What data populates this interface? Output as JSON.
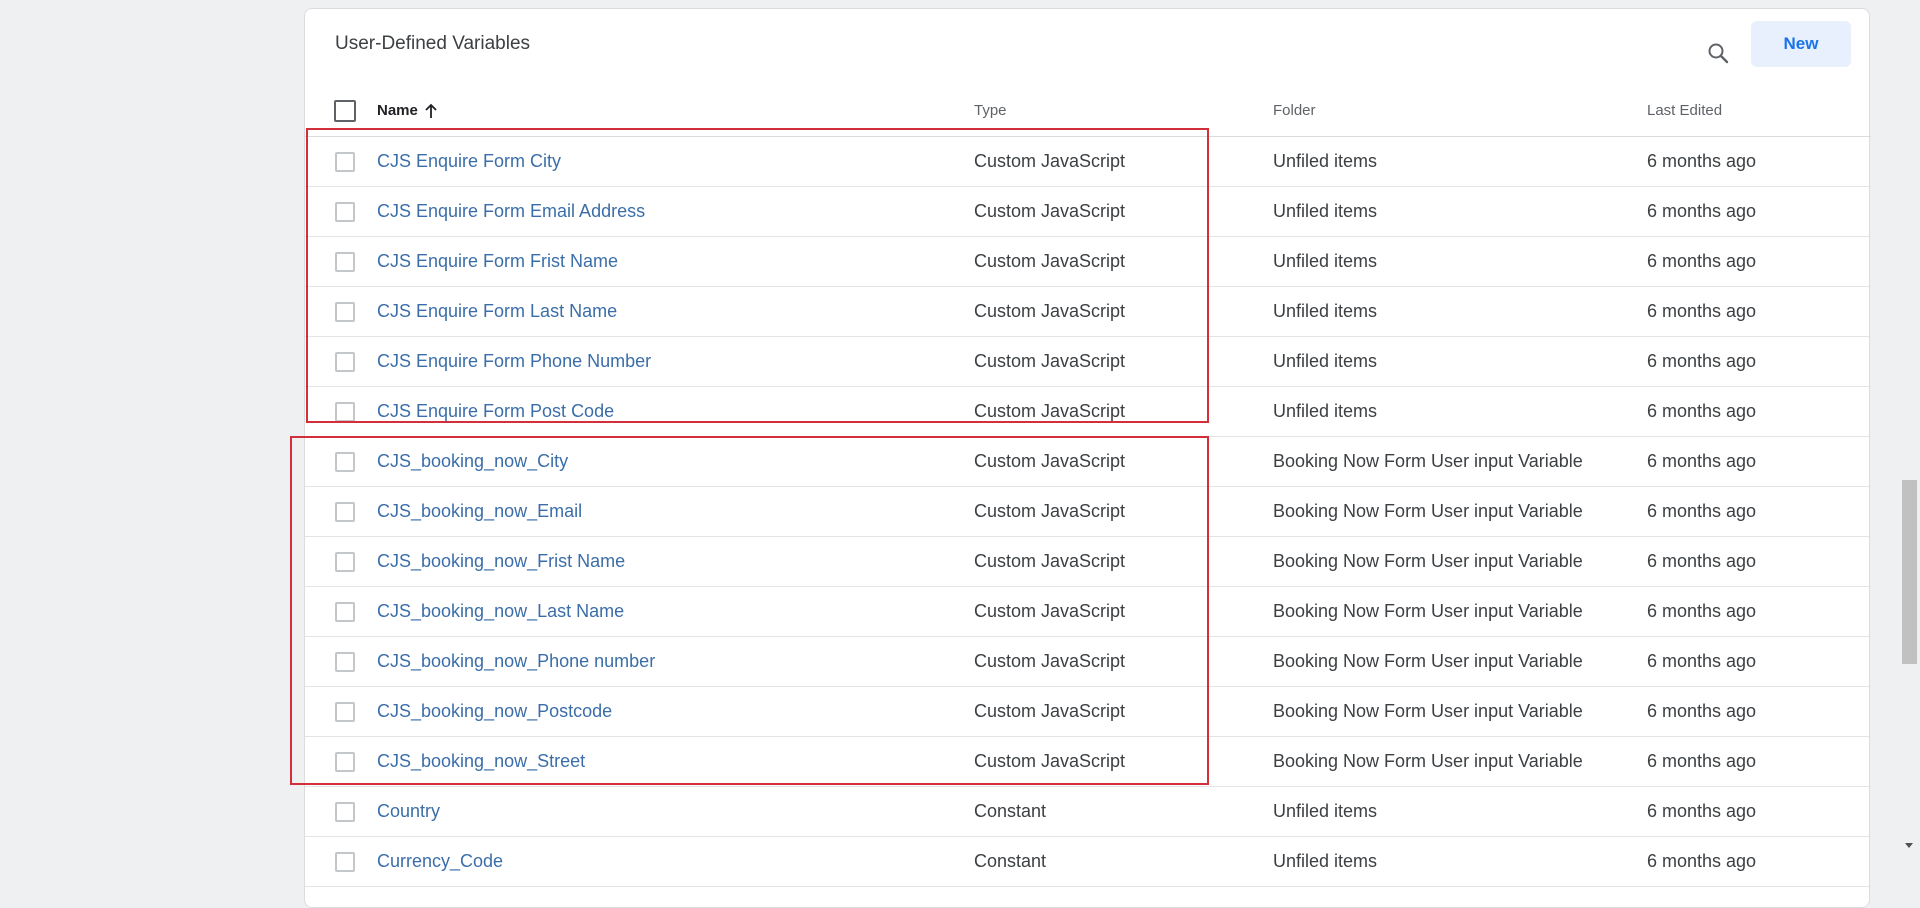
{
  "panel": {
    "title": "User-Defined Variables",
    "new_label": "New",
    "search_icon": "search-icon"
  },
  "columns": {
    "name": "Name",
    "type": "Type",
    "folder": "Folder",
    "last_edited": "Last Edited",
    "sort_icon": "arrow-up-icon"
  },
  "rows": [
    {
      "name": "CJS Enquire Form City",
      "type": "Custom JavaScript",
      "folder": "Unfiled items",
      "edited": "6 months ago"
    },
    {
      "name": "CJS Enquire Form Email Address",
      "type": "Custom JavaScript",
      "folder": "Unfiled items",
      "edited": "6 months ago"
    },
    {
      "name": "CJS Enquire Form Frist Name",
      "type": "Custom JavaScript",
      "folder": "Unfiled items",
      "edited": "6 months ago"
    },
    {
      "name": "CJS Enquire Form Last Name",
      "type": "Custom JavaScript",
      "folder": "Unfiled items",
      "edited": "6 months ago"
    },
    {
      "name": "CJS Enquire Form Phone Number",
      "type": "Custom JavaScript",
      "folder": "Unfiled items",
      "edited": "6 months ago"
    },
    {
      "name": "CJS Enquire Form Post Code",
      "type": "Custom JavaScript",
      "folder": "Unfiled items",
      "edited": "6 months ago"
    },
    {
      "name": "CJS_booking_now_City",
      "type": "Custom JavaScript",
      "folder": "Booking Now Form User input Variable",
      "edited": "6 months ago"
    },
    {
      "name": "CJS_booking_now_Email",
      "type": "Custom JavaScript",
      "folder": "Booking Now Form User input Variable",
      "edited": "6 months ago"
    },
    {
      "name": "CJS_booking_now_Frist Name",
      "type": "Custom JavaScript",
      "folder": "Booking Now Form User input Variable",
      "edited": "6 months ago"
    },
    {
      "name": "CJS_booking_now_Last Name",
      "type": "Custom JavaScript",
      "folder": "Booking Now Form User input Variable",
      "edited": "6 months ago"
    },
    {
      "name": "CJS_booking_now_Phone number",
      "type": "Custom JavaScript",
      "folder": "Booking Now Form User input Variable",
      "edited": "6 months ago"
    },
    {
      "name": "CJS_booking_now_Postcode",
      "type": "Custom JavaScript",
      "folder": "Booking Now Form User input Variable",
      "edited": "6 months ago"
    },
    {
      "name": "CJS_booking_now_Street",
      "type": "Custom JavaScript",
      "folder": "Booking Now Form User input Variable",
      "edited": "6 months ago"
    },
    {
      "name": "Country",
      "type": "Constant",
      "folder": "Unfiled items",
      "edited": "6 months ago"
    },
    {
      "name": "Currency_Code",
      "type": "Constant",
      "folder": "Unfiled items",
      "edited": "6 months ago"
    }
  ],
  "colors": {
    "link": "#3b6ea8",
    "highlight": "#d32f3a",
    "accent": "#1a73e8"
  }
}
